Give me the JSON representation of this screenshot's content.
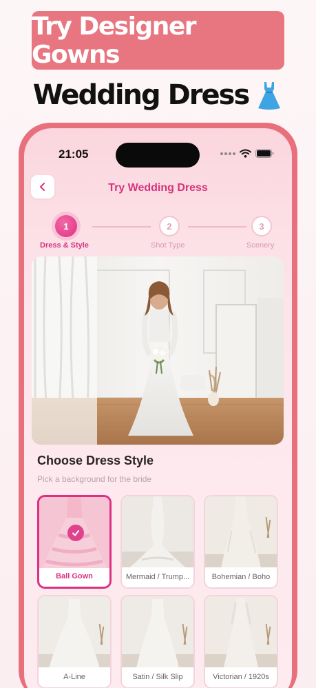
{
  "promo": {
    "headline": "Try Designer Gowns",
    "subheadline": "Wedding Dress"
  },
  "status_bar": {
    "time": "21:05"
  },
  "header": {
    "title": "Try Wedding Dress"
  },
  "stepper": [
    {
      "number": "1",
      "label": "Dress & Style",
      "active": true
    },
    {
      "number": "2",
      "label": "Shot Type",
      "active": false
    },
    {
      "number": "3",
      "label": "Scenery",
      "active": false
    }
  ],
  "section": {
    "title": "Choose Dress Style",
    "subtitle": "Pick a background for the bride"
  },
  "dress_styles": [
    {
      "label": "Ball Gown",
      "selected": true
    },
    {
      "label": "Mermaid / Trump...",
      "selected": false
    },
    {
      "label": "Bohemian / Boho",
      "selected": false
    },
    {
      "label": "A-Line",
      "selected": false
    },
    {
      "label": "Satin / Silk Slip",
      "selected": false
    },
    {
      "label": "Victorian / 1920s",
      "selected": false
    }
  ],
  "colors": {
    "accent": "#df2f83",
    "banner": "#e87680",
    "frame": "#e8707c"
  }
}
